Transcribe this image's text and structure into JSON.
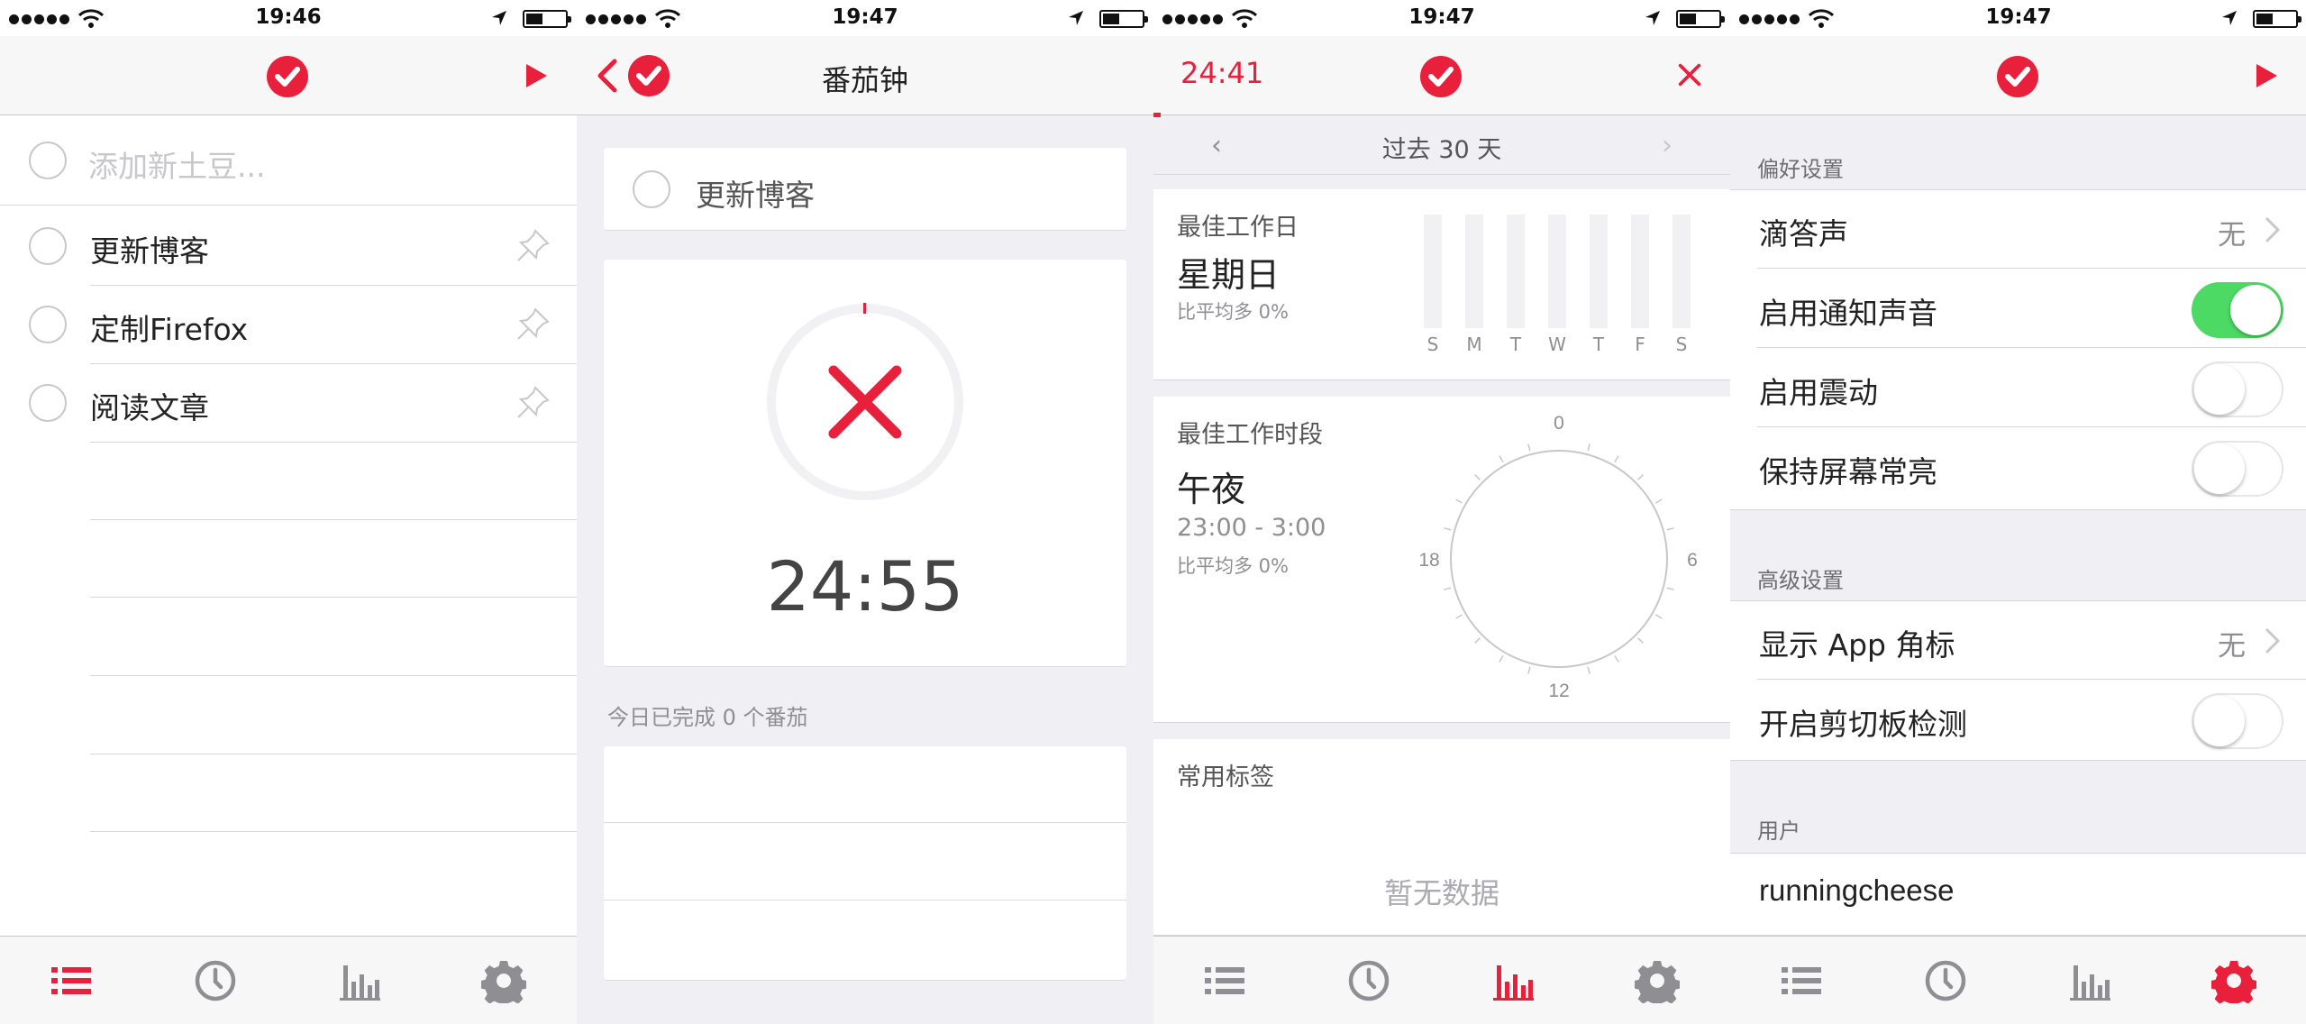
{
  "colors": {
    "accent": "#e8203b",
    "toggle_on": "#4cd964",
    "bg_grouped": "#efeff4"
  },
  "status_bars": [
    {
      "time": "19:46"
    },
    {
      "time": "19:47"
    },
    {
      "time": "19:47"
    },
    {
      "time": "19:47"
    }
  ],
  "screen1": {
    "nav": {
      "logo": "check-circle-icon",
      "right": "play-icon"
    },
    "add_placeholder": "添加新土豆...",
    "tasks": [
      {
        "label": "更新博客",
        "icon": "pin-icon"
      },
      {
        "label": "定制Firefox",
        "icon": "pin-icon"
      },
      {
        "label": "阅读文章",
        "icon": "pin-icon"
      }
    ],
    "active_tab": "list"
  },
  "screen2": {
    "nav_title": "番茄钟",
    "task_label": "更新博客",
    "timer": "24:55",
    "done_text": "今日已完成 0 个番茄",
    "active_tab": "none"
  },
  "screen3": {
    "nav_timer": "24:41",
    "range": "过去 30 天",
    "best_day": {
      "label": "最佳工作日",
      "value": "星期日",
      "compare": "比平均多 0%",
      "days": [
        "S",
        "M",
        "T",
        "W",
        "T",
        "F",
        "S"
      ]
    },
    "best_period": {
      "label": "最佳工作时段",
      "value": "午夜",
      "time": "23:00 - 3:00",
      "compare": "比平均多 0%",
      "clock_labels": {
        "top": "0",
        "right": "6",
        "bottom": "12",
        "left": "18"
      }
    },
    "tags": {
      "label": "常用标签",
      "empty": "暂无数据"
    },
    "active_tab": "stats"
  },
  "screen4": {
    "sections": {
      "prefs": "偏好设置",
      "advanced": "高级设置",
      "user": "用户"
    },
    "prefs_rows": [
      {
        "label": "滴答声",
        "value": "无",
        "type": "disclosure"
      },
      {
        "label": "启用通知声音",
        "type": "toggle",
        "on": true
      },
      {
        "label": "启用震动",
        "type": "toggle",
        "on": false
      },
      {
        "label": "保持屏幕常亮",
        "type": "toggle",
        "on": false
      }
    ],
    "advanced_rows": [
      {
        "label": "显示 App 角标",
        "value": "无",
        "type": "disclosure"
      },
      {
        "label": "开启剪切板检测",
        "type": "toggle",
        "on": false
      }
    ],
    "username": "runningcheese",
    "active_tab": "settings"
  }
}
